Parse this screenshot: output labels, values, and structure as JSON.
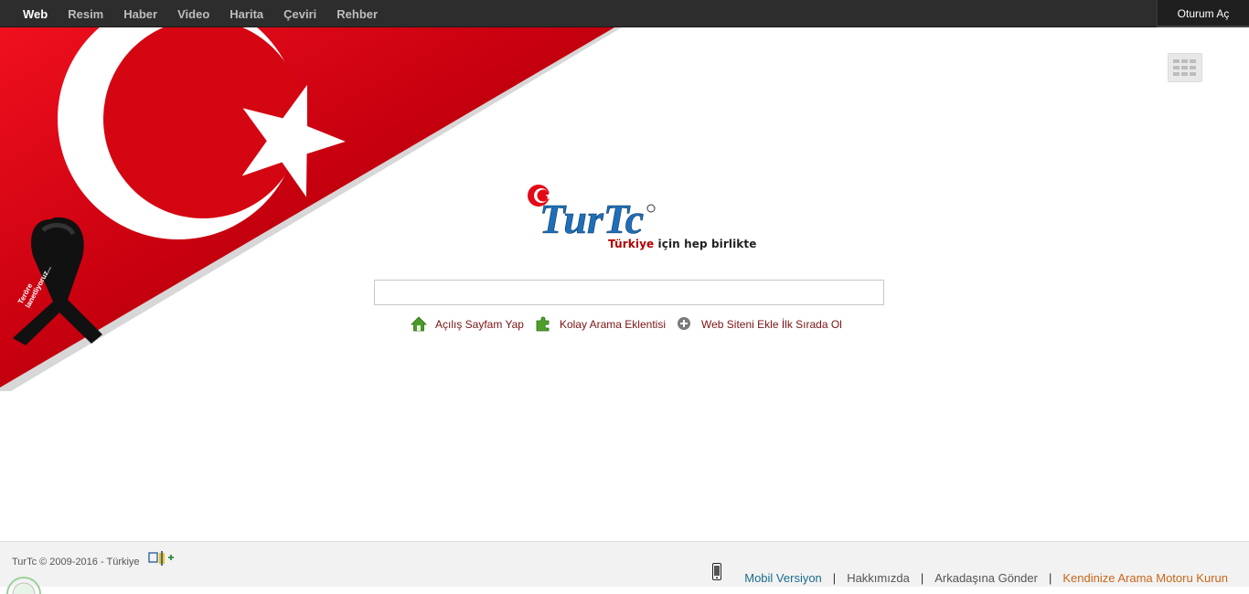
{
  "nav": {
    "items": [
      "Web",
      "Resim",
      "Haber",
      "Video",
      "Harita",
      "Çeviri",
      "Rehber"
    ],
    "active": "Web",
    "signin_label": "Oturum Aç"
  },
  "banner": {
    "ribbon_text_line1": "Teröre",
    "ribbon_text_line2": "lanetliyoruz..."
  },
  "apps_button": {
    "icon": "grid-icon"
  },
  "logo": {
    "text": "TurTc",
    "tagline_part1": "Türkiye ",
    "tagline_part2": "için hep birlikte"
  },
  "search": {
    "value": "",
    "placeholder": ""
  },
  "quick_links": [
    {
      "label": "Açılış Sayfam Yap",
      "icon": "home-icon"
    },
    {
      "label": "Kolay Arama Eklentisi",
      "icon": "puzzle-icon"
    },
    {
      "label": "Web Siteni Ekle İlk Sırada Ol",
      "icon": "plus-circle-icon"
    }
  ],
  "footer": {
    "copyright": "TurTc © 2009-2016 - Türkiye",
    "links": {
      "mobile": "Mobil Versiyon",
      "about": "Hakkımızda",
      "send_friend": "Arkadaşına Gönder",
      "install": "Kendinize Arama Motoru Kurun"
    },
    "separator": "|"
  },
  "colors": {
    "topbar": "#2d2d2d",
    "flag_red": "#e30a17",
    "link_red": "#7a1414",
    "install_orange": "#c8661a",
    "mobile_teal": "#1a6d8a"
  }
}
